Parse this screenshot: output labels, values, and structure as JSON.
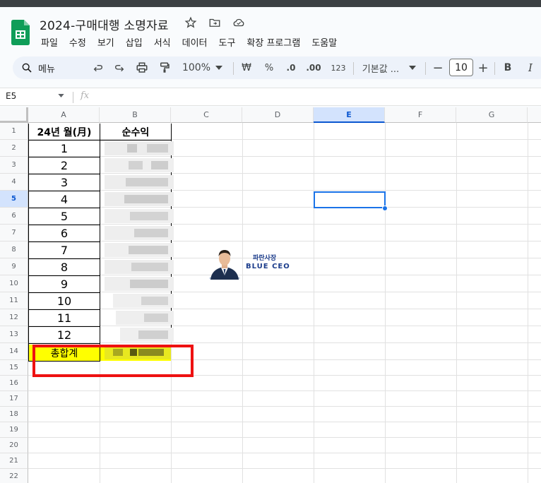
{
  "doc": {
    "title": "2024-구매대행 소명자료"
  },
  "menu": [
    "파일",
    "수정",
    "보기",
    "삽입",
    "서식",
    "데이터",
    "도구",
    "확장 프로그램",
    "도움말"
  ],
  "toolbar": {
    "search_label": "메뉴",
    "zoom": "100%",
    "currency": "₩",
    "percent": "%",
    "dec_decrease": ".0",
    "dec_increase": ".00",
    "number_format": "123",
    "font_name": "기본값 ...",
    "font_size": "10",
    "bold": "B",
    "italic": "I",
    "minus": "−",
    "plus": "+"
  },
  "formula": {
    "name_box": "E5",
    "fx": "fx"
  },
  "columns": [
    "A",
    "B",
    "C",
    "D",
    "E",
    "F",
    "G"
  ],
  "selected_column": "E",
  "rows": [
    "1",
    "2",
    "3",
    "4",
    "5",
    "6",
    "7",
    "8",
    "9",
    "10",
    "11",
    "12",
    "13",
    "14",
    "15",
    "16",
    "17",
    "18",
    "19",
    "20",
    "21",
    "22"
  ],
  "selected_row": "5",
  "sheet": {
    "header_month": "24년 월(月)",
    "header_profit": "순수익",
    "months": [
      "1",
      "2",
      "3",
      "4",
      "5",
      "6",
      "7",
      "8",
      "9",
      "10",
      "11",
      "12"
    ],
    "total_label": "총합계",
    "selected_cell": "E5"
  },
  "watermark": {
    "line1": "파란사장",
    "line2": "BLUE CEO"
  },
  "colors": {
    "accent": "#1a73e8",
    "highlight_yellow": "#ffff00",
    "annotation_red": "#ee1111"
  }
}
